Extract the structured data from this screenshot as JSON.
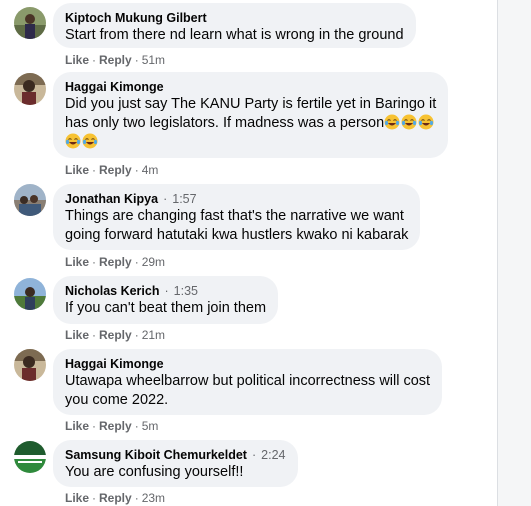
{
  "comments": [
    {
      "author": "Kiptoch Mukung Gilbert",
      "time": "",
      "text": "Start from there nd learn what is wrong in the ground",
      "like_label": "Like",
      "reply_label": "Reply",
      "age": "51m"
    },
    {
      "author": "Haggai Kimonge",
      "time": "",
      "text_line1": "Did you just say The KANU Party is fertile yet in Baringo it",
      "text_line2": "has only two legislators. If madness was a person",
      "emoji_name": "face-with-tears-of-joy",
      "emoji_count": 5,
      "like_label": "Like",
      "reply_label": "Reply",
      "age": "4m"
    },
    {
      "author": "Jonathan Kipya",
      "time": "1:57",
      "text_line1": "Things are changing fast that's the narrative we want",
      "text_line2": "going forward hatutaki kwa hustlers kwako ni kabarak",
      "like_label": "Like",
      "reply_label": "Reply",
      "age": "29m"
    },
    {
      "author": "Nicholas Kerich",
      "time": "1:35",
      "text": "If you can't beat them join them",
      "like_label": "Like",
      "reply_label": "Reply",
      "age": "21m"
    },
    {
      "author": "Haggai Kimonge",
      "time": "",
      "text_line1": "Utawapa wheelbarrow but political incorrectness will cost",
      "text_line2": "you come 2022.",
      "like_label": "Like",
      "reply_label": "Reply",
      "age": "5m"
    },
    {
      "author": "Samsung Kiboit Chemurkeldet",
      "time": "2:24",
      "text": "You are confusing yourself!!",
      "like_label": "Like",
      "reply_label": "Reply",
      "age": "23m"
    }
  ],
  "separators": {
    "dot": "·"
  },
  "colors": {
    "bubble": "#f0f2f5",
    "secondary_text": "#65676b",
    "primary_text": "#050505"
  }
}
